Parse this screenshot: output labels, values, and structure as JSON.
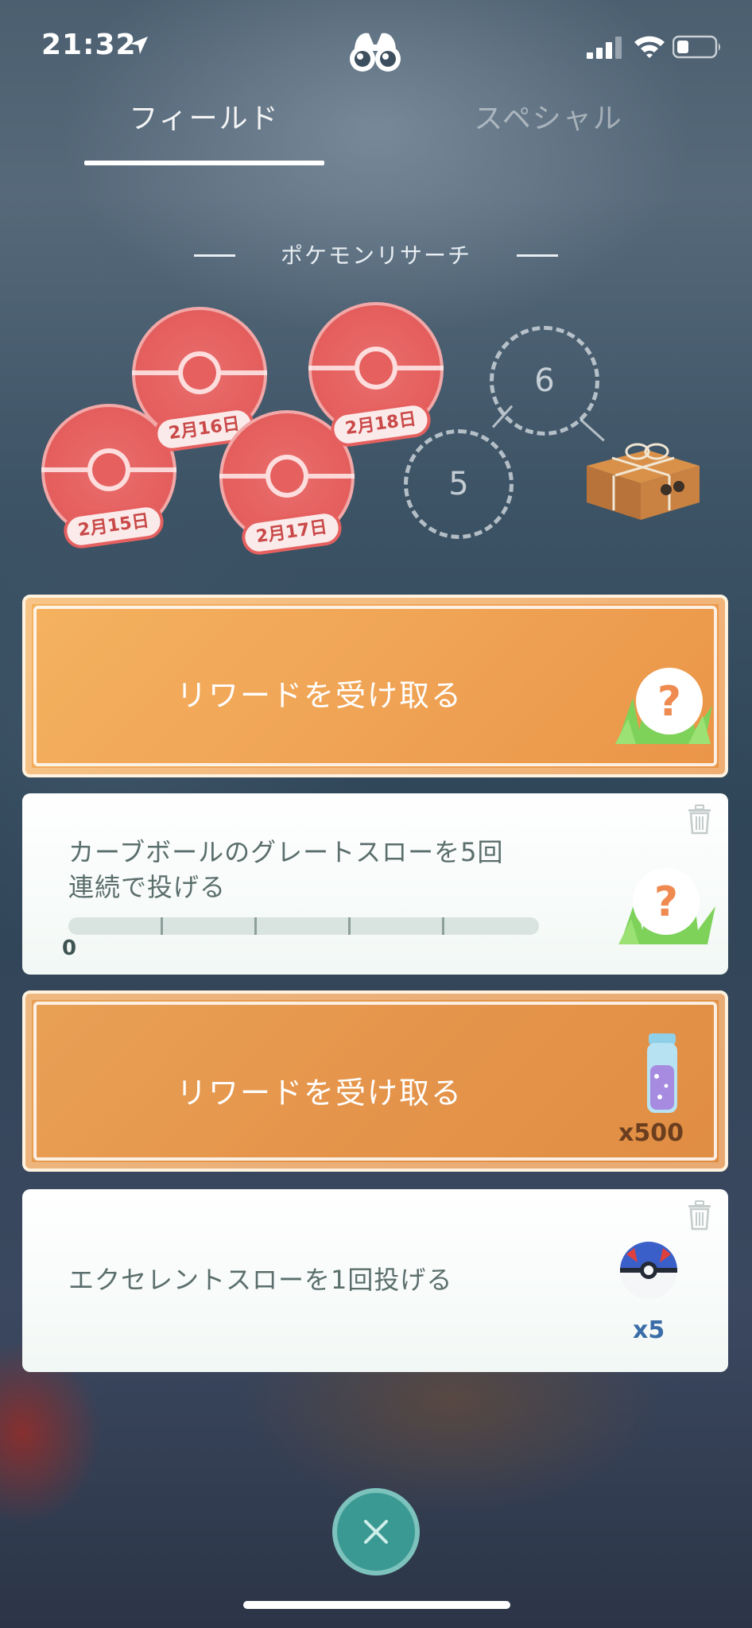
{
  "status_bar": {
    "time": "21:32"
  },
  "tabs": [
    {
      "label": "フィールド",
      "active": true
    },
    {
      "label": "スペシャル",
      "active": false
    }
  ],
  "section_title": "ポケモンリサーチ",
  "stamps": [
    {
      "date": "2月15日",
      "collected": true
    },
    {
      "date": "2月16日",
      "collected": true
    },
    {
      "date": "2月17日",
      "collected": true
    },
    {
      "date": "2月18日",
      "collected": true
    }
  ],
  "empty_slots": [
    "5",
    "6"
  ],
  "tasks": [
    {
      "type": "claim",
      "label": "リワードを受け取る",
      "reward_icon": "mystery-reward-grass-icon"
    },
    {
      "type": "progress",
      "text_line1": "カーブボールのグレートスローを5回",
      "text_line2": "連続で投げる",
      "progress": 0,
      "progress_label": "0",
      "goal": 5,
      "reward_icon": "mystery-reward-grass-icon"
    },
    {
      "type": "claim",
      "label": "リワードを受け取る",
      "reward_icon": "stardust-vial-icon",
      "reward_count": "x500"
    },
    {
      "type": "task",
      "text": "エクセレントスローを1回投げる",
      "reward_icon": "great-ball-icon",
      "reward_count": "x5"
    }
  ],
  "colors": {
    "claim_card": "#f0a456",
    "stamp_red": "#e5605f",
    "task_text": "#5a6e6c",
    "reward_count_blue": "#3b6ea8",
    "close_button": "#3a9a93"
  }
}
